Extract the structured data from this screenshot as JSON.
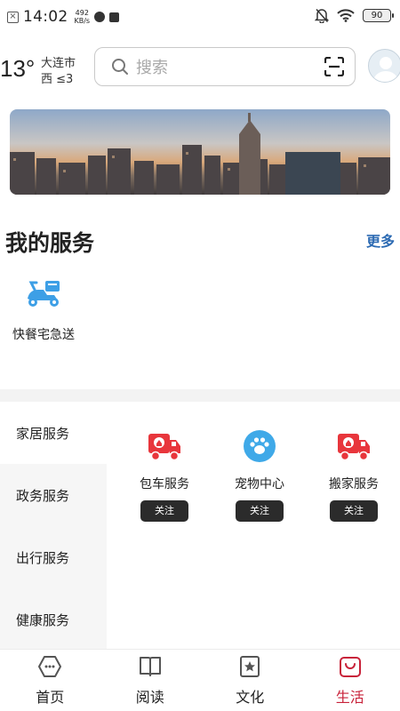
{
  "status_bar": {
    "time": "14:02",
    "speed_value": "492",
    "speed_unit": "KB/s",
    "battery": "90"
  },
  "weather": {
    "temperature": "13°",
    "city": "大连市",
    "wind": "西  ≤3"
  },
  "search": {
    "placeholder": "搜索"
  },
  "my_services": {
    "title": "我的服务",
    "more_label": "更多",
    "items": [
      {
        "label": "快餐宅急送",
        "icon": "scooter-icon"
      }
    ]
  },
  "categories": {
    "items": [
      {
        "label": "家居服务",
        "active": true
      },
      {
        "label": "政务服务",
        "active": false
      },
      {
        "label": "出行服务",
        "active": false
      },
      {
        "label": "健康服务",
        "active": false
      }
    ]
  },
  "service_cards": [
    {
      "label": "包车服务",
      "icon": "truck-icon",
      "button": "关注"
    },
    {
      "label": "宠物中心",
      "icon": "paw-icon",
      "button": "关注"
    },
    {
      "label": "搬家服务",
      "icon": "truck-icon",
      "button": "关注"
    }
  ],
  "bottom_nav": {
    "items": [
      {
        "label": "首页",
        "icon": "home-icon"
      },
      {
        "label": "阅读",
        "icon": "book-icon"
      },
      {
        "label": "文化",
        "icon": "star-badge-icon"
      },
      {
        "label": "生活",
        "icon": "bag-icon",
        "active": true
      }
    ]
  },
  "colors": {
    "accent_blue": "#2d6bb3",
    "service_red": "#e8363c",
    "paw_blue": "#3fa9e8",
    "nav_active": "#c8223a",
    "scooter_blue": "#3d9fe6"
  }
}
